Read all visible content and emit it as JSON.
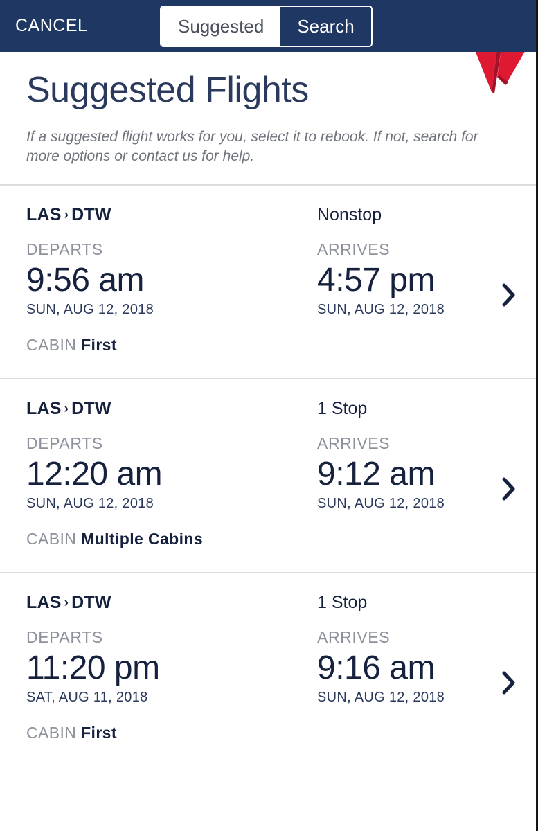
{
  "header": {
    "cancel_label": "CANCEL",
    "segmented": {
      "suggested_label": "Suggested",
      "search_label": "Search",
      "selected": "Suggested"
    },
    "logo_name": "delta-widget-logo",
    "background_color": "#1f3763"
  },
  "page": {
    "title": "Suggested Flights",
    "subtitle": "If a suggested flight works for you, select it to rebook. If not, search for more options or contact us for help."
  },
  "labels": {
    "departs": "DEPARTS",
    "arrives": "ARRIVES",
    "cabin": "CABIN",
    "route_separator": "›"
  },
  "colors": {
    "navy": "#1f3763",
    "text_dark": "#16213e",
    "text_muted": "#8d919b",
    "delta_red_light": "#e01933",
    "delta_red_dark": "#a8102a",
    "divider": "#dcdcdc"
  },
  "flights": [
    {
      "origin": "LAS",
      "destination": "DTW",
      "stops": "Nonstop",
      "depart_time": "9:56 am",
      "depart_date": "SUN, AUG 12, 2018",
      "arrive_time": "4:57 pm",
      "arrive_date": "SUN, AUG 12, 2018",
      "cabin": "First"
    },
    {
      "origin": "LAS",
      "destination": "DTW",
      "stops": "1 Stop",
      "depart_time": "12:20 am",
      "depart_date": "SUN, AUG 12, 2018",
      "arrive_time": "9:12 am",
      "arrive_date": "SUN, AUG 12, 2018",
      "cabin": "Multiple Cabins"
    },
    {
      "origin": "LAS",
      "destination": "DTW",
      "stops": "1 Stop",
      "depart_time": "11:20 pm",
      "depart_date": "SAT, AUG 11, 2018",
      "arrive_time": "9:16 am",
      "arrive_date": "SUN, AUG 12, 2018",
      "cabin": "First"
    }
  ]
}
